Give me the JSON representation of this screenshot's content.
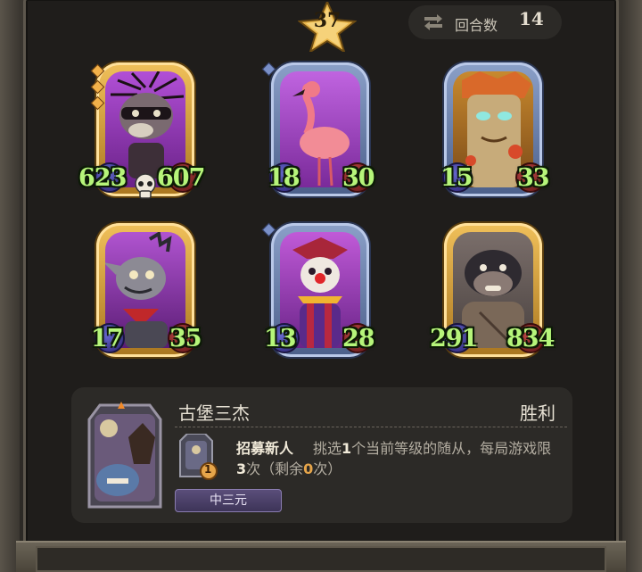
{
  "header": {
    "tier": "37",
    "round_label": "回合数",
    "round_value": "14"
  },
  "board": {
    "minions": [
      {
        "name": "hedgehog-bandit",
        "frame": "gold",
        "attack": "623",
        "health": "607",
        "tier_dots": 3,
        "has_skull": true
      },
      {
        "name": "flamingo",
        "frame": "silver",
        "attack": "18",
        "health": "30"
      },
      {
        "name": "tree-ent",
        "frame": "silver",
        "attack": "15",
        "health": "33"
      },
      {
        "name": "punk-rat",
        "frame": "gold",
        "attack": "17",
        "health": "35"
      },
      {
        "name": "clown",
        "frame": "silver",
        "attack": "13",
        "health": "28"
      },
      {
        "name": "gorilla",
        "frame": "gold",
        "attack": "291",
        "health": "834"
      }
    ]
  },
  "info": {
    "title": "古堡三杰",
    "result": "胜利",
    "skill_name": "招募新人",
    "skill_desc_parts": [
      "挑选",
      "1",
      "个当前等级的随从，每局游戏限",
      "3",
      "次（剩余",
      "0",
      "次）"
    ],
    "hero_name": "中三元",
    "skill_badge": "1"
  },
  "colors": {
    "stat_text": "#b6f57a",
    "gold_frame": "#f0c05a",
    "silver_frame": "#8ba0c8",
    "panel_bg": "#2c2a27"
  }
}
